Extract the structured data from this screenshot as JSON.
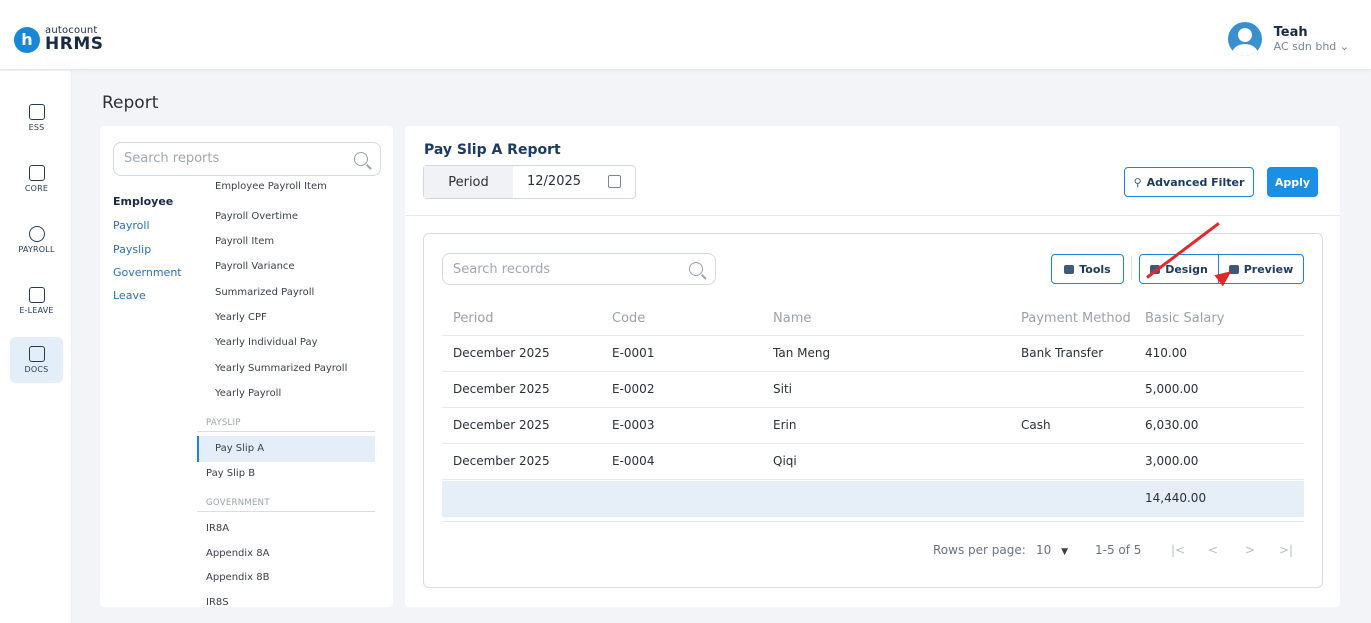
{
  "brand": {
    "top": "autocount",
    "bottom": "HRMS",
    "mark": "h"
  },
  "user": {
    "name": "Teah",
    "company": "AC sdn bhd"
  },
  "nav": [
    {
      "label": "ESS"
    },
    {
      "label": "CORE"
    },
    {
      "label": "PAYROLL"
    },
    {
      "label": "E-LEAVE"
    },
    {
      "label": "DOCS"
    }
  ],
  "page_title": "Report",
  "search_reports": {
    "placeholder": "Search reports"
  },
  "categories": [
    "Employee",
    "Payroll",
    "Payslip",
    "Government",
    "Leave"
  ],
  "reports": {
    "items": [
      "Employee Payroll Item",
      "Payroll Overtime",
      "Payroll Item",
      "Payroll Variance",
      "Summarized Payroll",
      "Yearly CPF",
      "Yearly Individual Pay",
      "Yearly Summarized Payroll",
      "Yearly Payroll"
    ],
    "payslip_header": "PAYSLIP",
    "payslip_items": [
      "Pay Slip A",
      "Pay Slip B"
    ],
    "government_header": "GOVERNMENT",
    "government_items": [
      "IR8A",
      "Appendix 8A",
      "Appendix 8B",
      "IR8S"
    ]
  },
  "report": {
    "title": "Pay Slip A Report",
    "period_label": "Period",
    "period_value": "12/2025",
    "advanced_filter": "Advanced Filter",
    "apply": "Apply",
    "search_records": "Search records",
    "tools": "Tools",
    "design": "Design",
    "preview": "Preview"
  },
  "table": {
    "headers": [
      "Period",
      "Code",
      "Name",
      "Payment Method",
      "Basic Salary"
    ],
    "rows": [
      [
        "December 2025",
        "E-0001",
        "Tan Meng",
        "Bank Transfer",
        "410.00"
      ],
      [
        "December 2025",
        "E-0002",
        "Siti",
        "",
        "5,000.00"
      ],
      [
        "December 2025",
        "E-0003",
        "Erin",
        "Cash",
        "6,030.00"
      ],
      [
        "December 2025",
        "E-0004",
        "Qiqi",
        "",
        "3,000.00"
      ]
    ],
    "total": "14,440.00"
  },
  "pagination": {
    "rows_per_page_label": "Rows per page:",
    "rows_per_page": "10",
    "range": "1-5 of 5"
  }
}
